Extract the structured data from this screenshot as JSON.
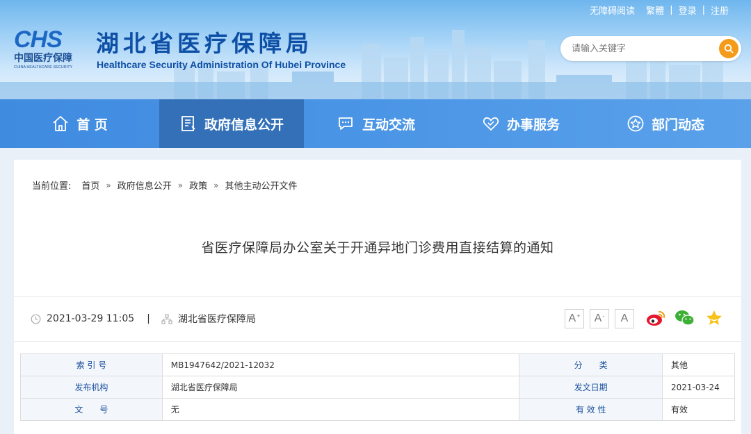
{
  "top_links": {
    "accessible": "无障碍阅读",
    "traditional": "繁體",
    "login": "登录",
    "register": "注册",
    "sep": "|"
  },
  "logo": {
    "brand": "CHS",
    "cn": "中国医疗保障",
    "en": "CHINA HEALTHCARE SECURITY"
  },
  "site": {
    "title": "湖北省医疗保障局",
    "subtitle_en": "Healthcare Security Administration Of Hubei Province"
  },
  "search": {
    "placeholder": "请输入关键字",
    "icon": "search-icon"
  },
  "nav": {
    "items": [
      {
        "label": "首 页",
        "icon": "home-icon"
      },
      {
        "label": "政府信息公开",
        "icon": "document-icon"
      },
      {
        "label": "互动交流",
        "icon": "chat-icon"
      },
      {
        "label": "办事服务",
        "icon": "heart-icon"
      },
      {
        "label": "部门动态",
        "icon": "star-icon"
      }
    ],
    "active_index": 1
  },
  "breadcrumb": {
    "label": "当前位置:",
    "items": [
      "首页",
      "政府信息公开",
      "政策",
      "其他主动公开文件"
    ],
    "separator": "»"
  },
  "doc": {
    "title": "省医疗保障局办公室关于开通异地门诊费用直接结算的通知",
    "datetime": "2021-03-29 11:05",
    "divider": "|",
    "org": "湖北省医疗保障局"
  },
  "font_size_buttons": {
    "large": "A",
    "large_mark": "+",
    "small": "A",
    "small_mark": "-",
    "default": "A"
  },
  "share_icons": [
    "weibo-icon",
    "wechat-icon",
    "favorite-icon"
  ],
  "info_table": {
    "rows": [
      {
        "k1": "索 引 号",
        "v1": "MB1947642/2021-12032",
        "k2": "分　　类",
        "v2": "其他"
      },
      {
        "k1": "发布机构",
        "v1": "湖北省医疗保障局",
        "k2": "发文日期",
        "v2": "2021-03-24"
      },
      {
        "k1": "文　　号",
        "v1": "无",
        "k2": "有 效 性",
        "v2": "有效"
      }
    ]
  },
  "colors": {
    "nav_bg": "#4b95e6",
    "nav_active": "#3470b8",
    "brand_blue": "#0e4fa6",
    "search_button": "#f49b1b",
    "label_blue": "#1a4f9c"
  }
}
